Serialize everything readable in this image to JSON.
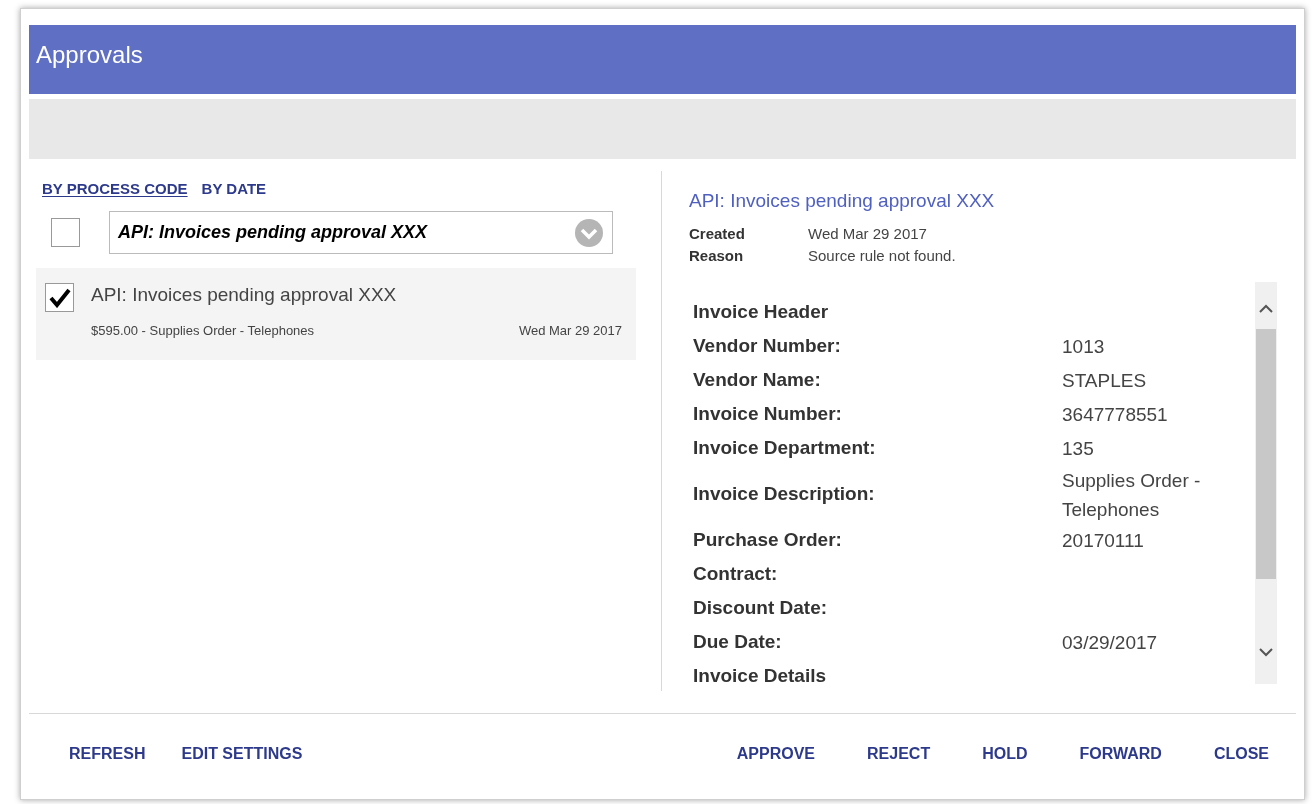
{
  "window": {
    "title": "Approvals"
  },
  "view_tabs": [
    {
      "label": "BY PROCESS CODE",
      "selected": true
    },
    {
      "label": "BY DATE",
      "selected": false
    }
  ],
  "filter": {
    "checked": false,
    "value": "API: Invoices pending approval XXX"
  },
  "items": [
    {
      "title": "API: Invoices pending approval XXX",
      "subtitle": "$595.00 - Supplies Order - Telephones",
      "date": "Wed Mar 29 2017",
      "checked": true
    }
  ],
  "detail": {
    "title": "API: Invoices pending approval XXX",
    "meta": [
      {
        "label": "Created",
        "value": "Wed Mar 29 2017"
      },
      {
        "label": "Reason",
        "value": "Source rule not found."
      }
    ],
    "fields": [
      {
        "label": "Invoice Header"
      },
      {
        "label": "Vendor Number:",
        "value": "1013"
      },
      {
        "label": "Vendor Name:",
        "value": "STAPLES"
      },
      {
        "label": "Invoice Number:",
        "value": "3647778551"
      },
      {
        "label": "Invoice Department:",
        "value": "135"
      },
      {
        "label": "Invoice Description:",
        "value": "Supplies Order - Telephones"
      },
      {
        "label": "Purchase Order:",
        "value": "20170111"
      },
      {
        "label": "Contract:"
      },
      {
        "label": "Discount Date:"
      },
      {
        "label": "Due Date:",
        "value": "03/29/2017"
      },
      {
        "label": "Invoice Details"
      }
    ]
  },
  "footer_left": [
    "REFRESH",
    "EDIT SETTINGS"
  ],
  "footer_right": [
    "APPROVE",
    "REJECT",
    "HOLD",
    "FORWARD",
    "CLOSE"
  ]
}
